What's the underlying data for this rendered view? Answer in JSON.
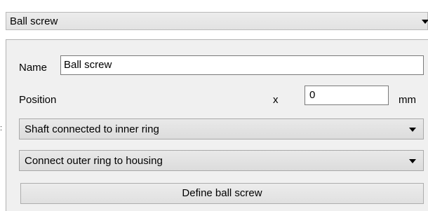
{
  "header": {
    "selected_component": "Ball screw"
  },
  "panel": {
    "name_label": "Name",
    "name_value": "Ball screw",
    "position_label": "Position",
    "axis_label": "x",
    "position_value": "0",
    "unit_label": "mm",
    "shaft_connection": "Shaft connected to inner ring",
    "housing_connection": "Connect outer ring to housing",
    "define_button_label": "Define ball screw"
  },
  "icons": {
    "dropdown": "chevron-down-icon"
  }
}
